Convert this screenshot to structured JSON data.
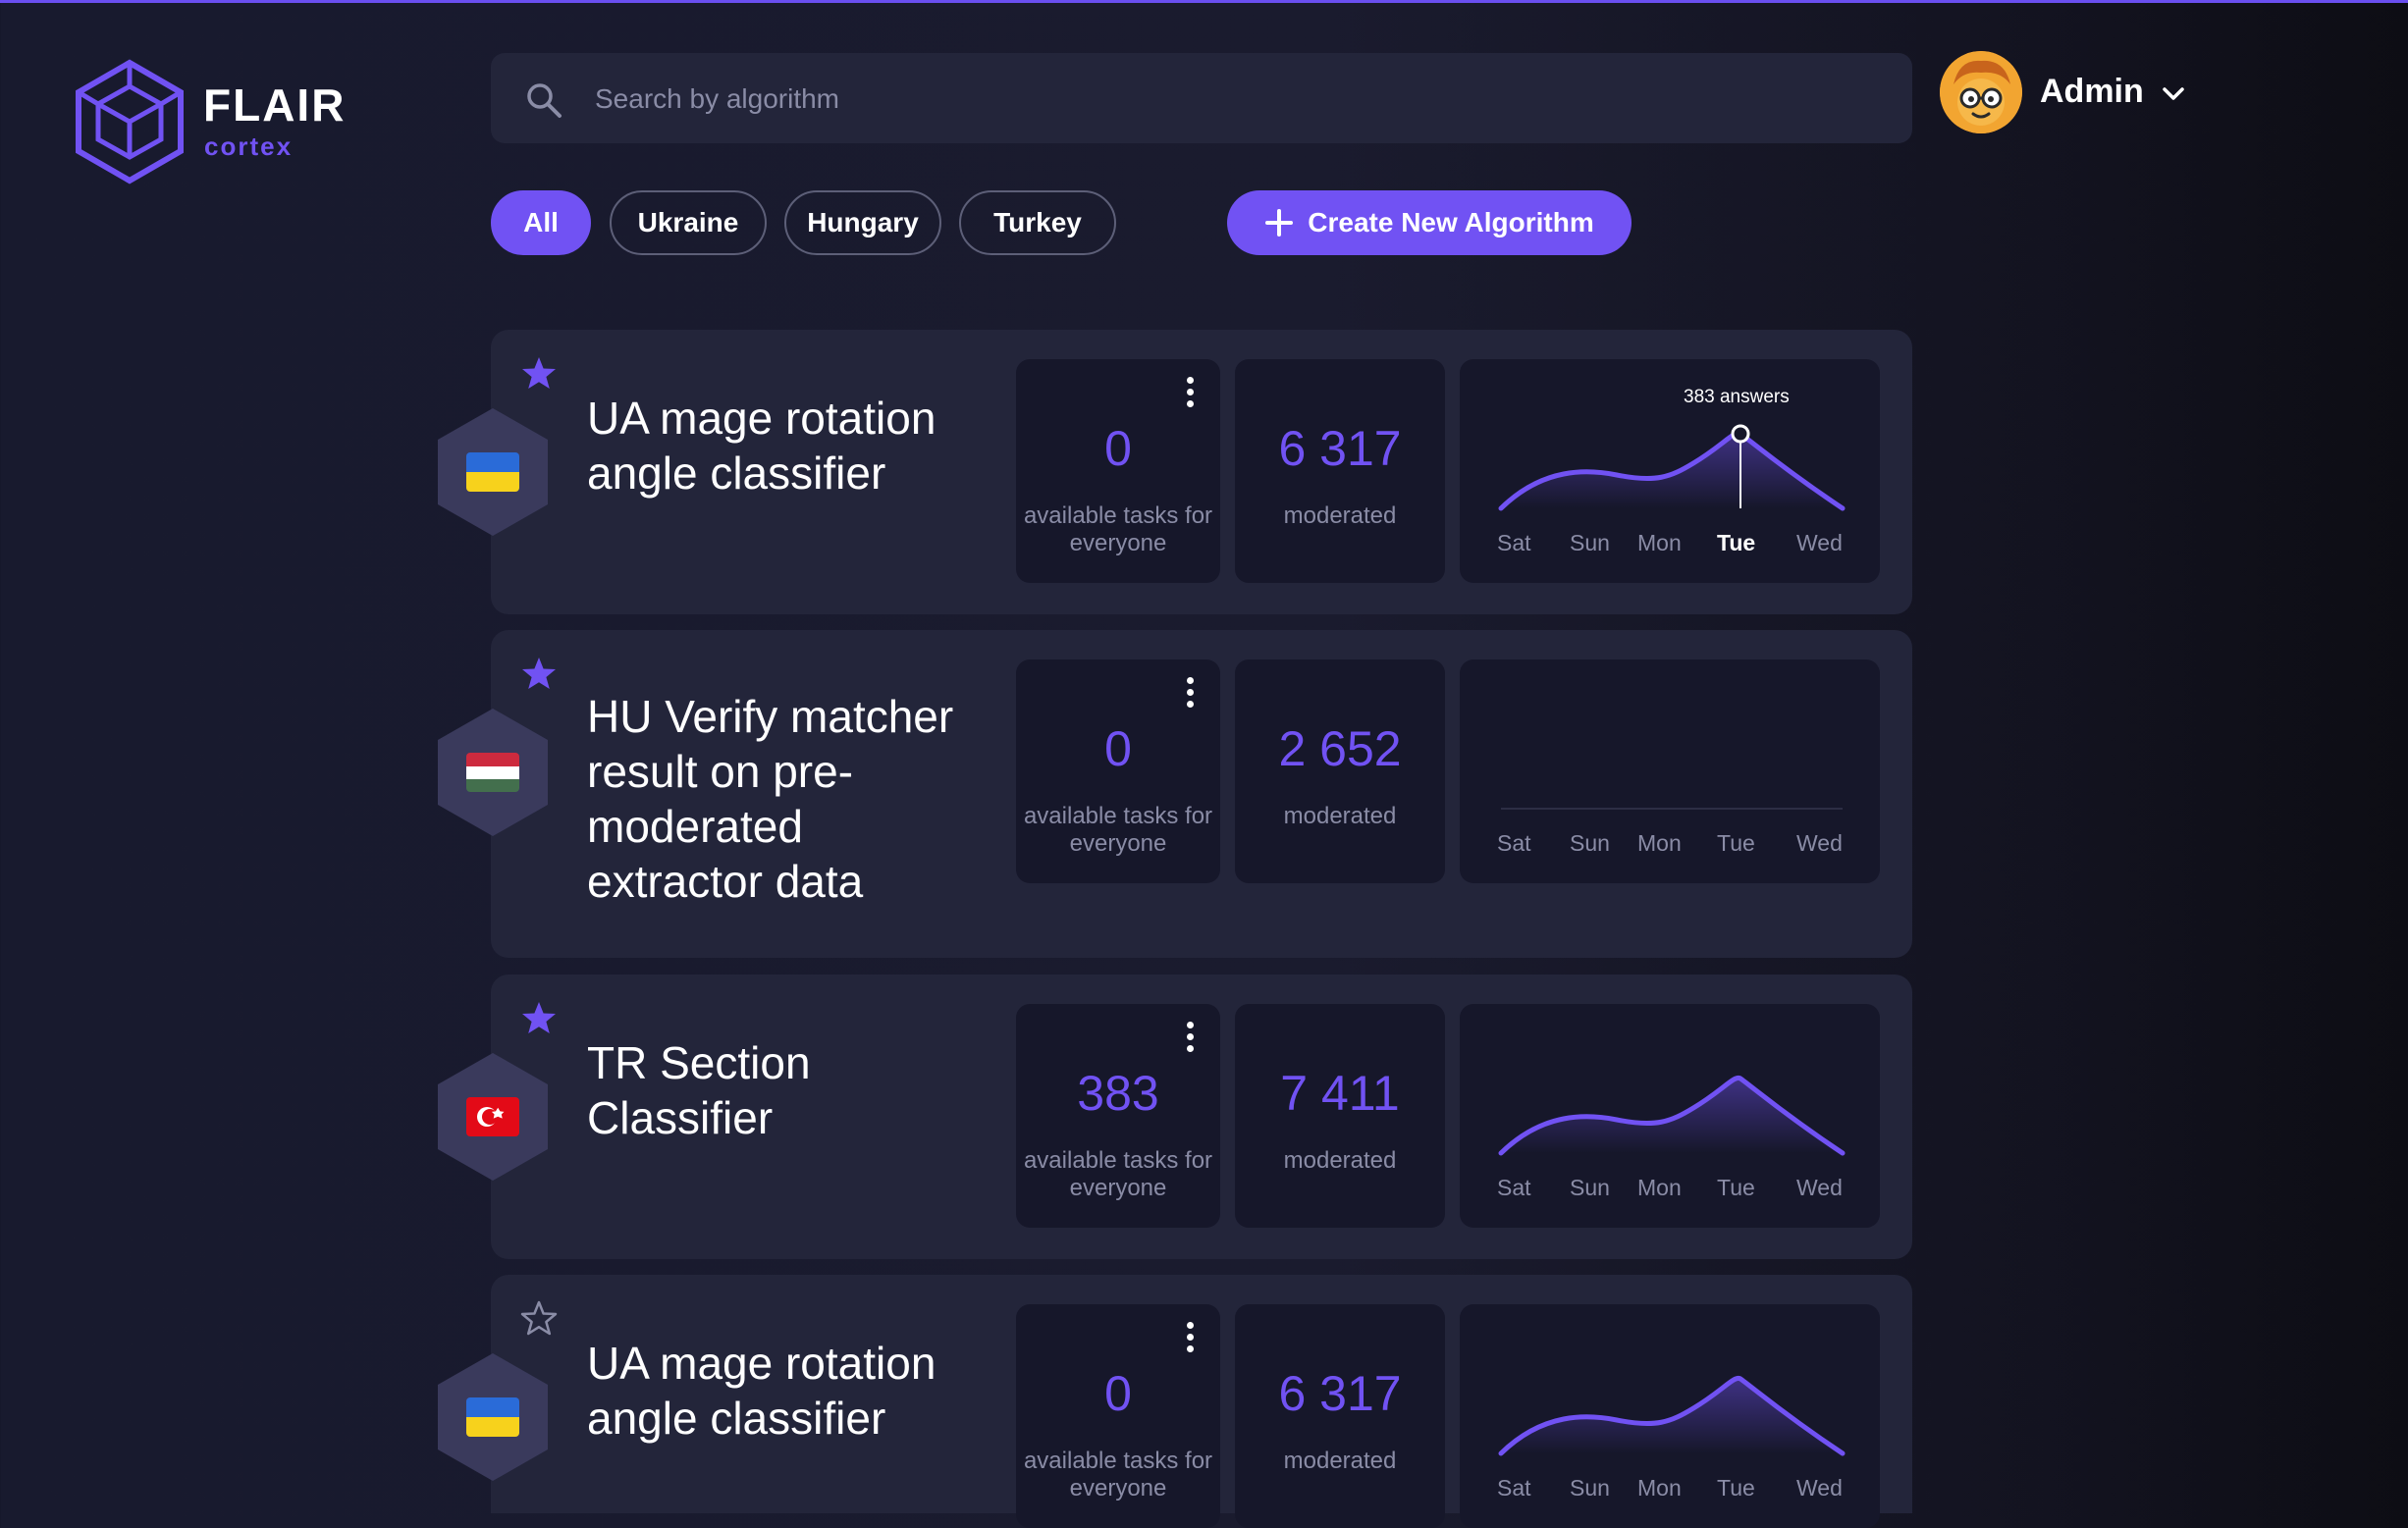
{
  "brand": {
    "name": "FLAIR",
    "sub": "cortex",
    "accent": "#7152f3"
  },
  "search": {
    "placeholder": "Search by algorithm"
  },
  "user": {
    "name": "Admin"
  },
  "filters": [
    "All",
    "Ukraine",
    "Hungary",
    "Turkey"
  ],
  "create_button": {
    "label": "Create New Algorithm"
  },
  "days": [
    "Sat",
    "Sun",
    "Mon",
    "Tue",
    "Wed"
  ],
  "cards": [
    {
      "title": "UA mage rotation angle classifier",
      "flag": "ukraine",
      "starred": true,
      "tasks": "0",
      "tasks_label": "available tasks for everyone",
      "moderated": "6 317",
      "moderated_label": "moderated",
      "tooltip": "383 answers",
      "active_day": "Tue"
    },
    {
      "title": "HU Verify matcher result on pre-moderated extractor data",
      "flag": "hungary",
      "starred": true,
      "tasks": "0",
      "tasks_label": "available tasks for everyone",
      "moderated": "2 652",
      "moderated_label": "moderated"
    },
    {
      "title": "TR Section Classifier",
      "flag": "turkey",
      "starred": true,
      "tasks": "383",
      "tasks_label": "available tasks for everyone",
      "moderated": "7 411",
      "moderated_label": "moderated"
    },
    {
      "title": "UA mage rotation angle classifier",
      "flag": "ukraine",
      "starred": false,
      "tasks": "0",
      "tasks_label": "available tasks for everyone",
      "moderated": "6 317",
      "moderated_label": "moderated"
    }
  ],
  "icons": {
    "search": "search-icon",
    "chevron": "chevron-down-icon",
    "star": "star-icon",
    "more": "more-vertical-icon",
    "plus": "plus-icon"
  }
}
